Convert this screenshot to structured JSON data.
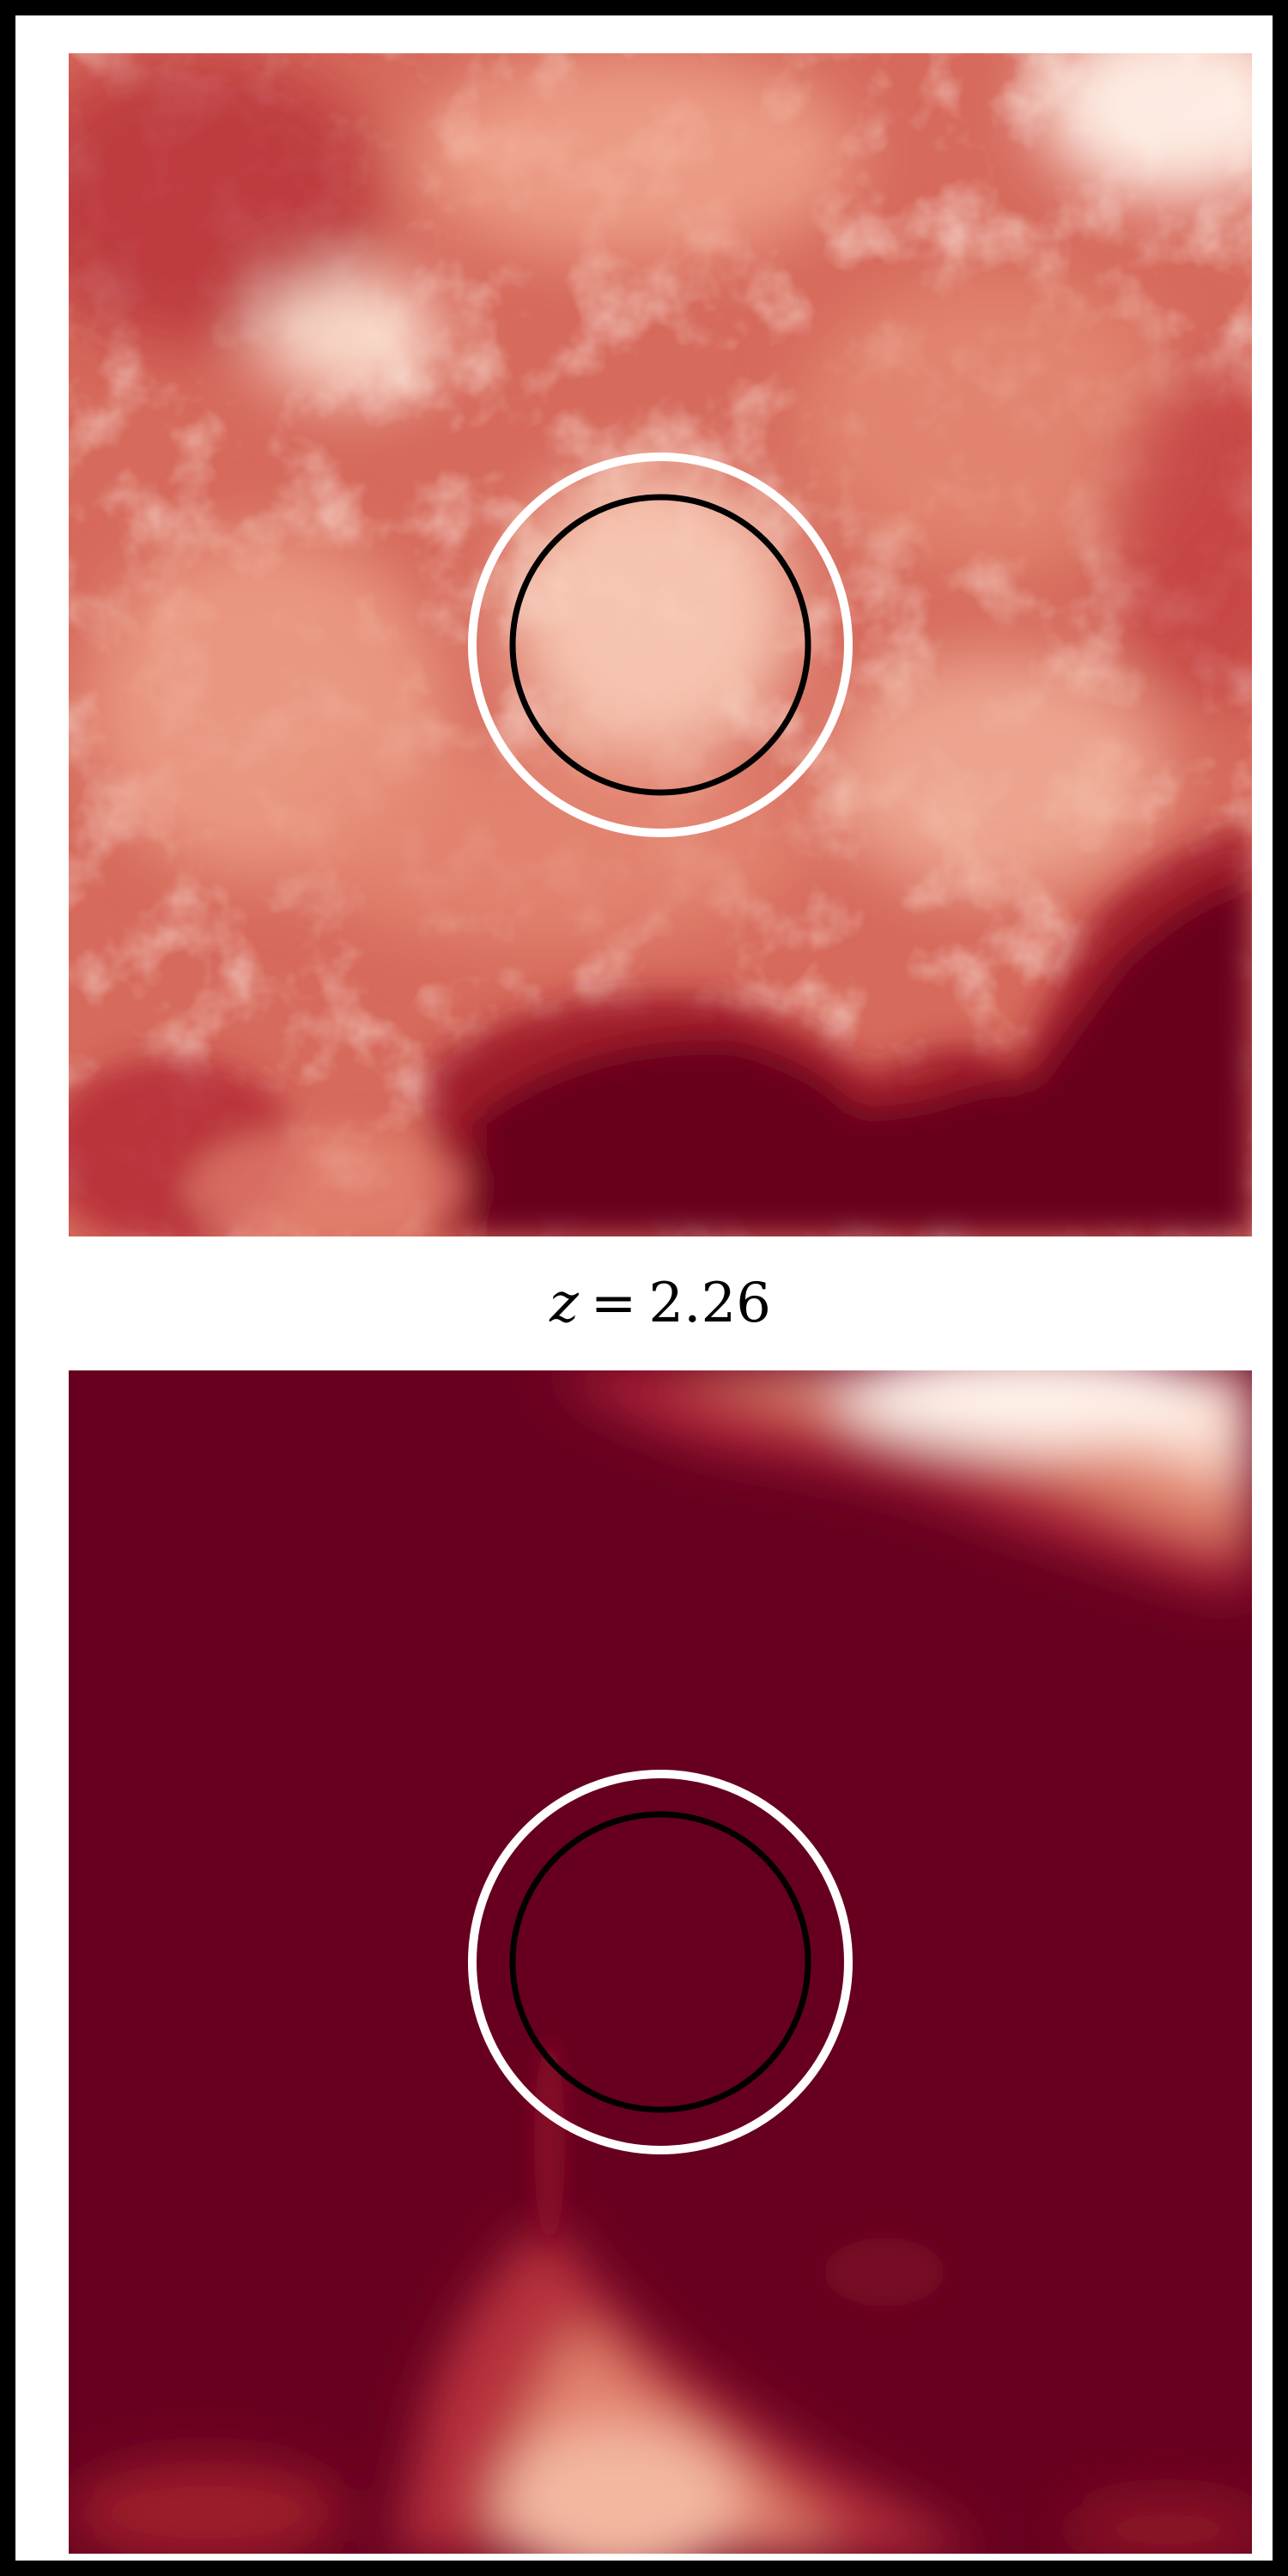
{
  "caption": {
    "variable": "z",
    "equals": "=",
    "value": "2.26"
  },
  "colors": {
    "frame": "#000000",
    "background": "#ffffff",
    "colormap_dark": "#67001f",
    "colormap_mid": "#c73a3d",
    "colormap_light": "#fddbc7",
    "colormap_lightest": "#fff5ee",
    "outer_ring": "#ffffff",
    "inner_ring": "#000000"
  },
  "panels": [
    {
      "name": "top-map",
      "description_icon": "density-map"
    },
    {
      "name": "bottom-map",
      "description_icon": "density-map"
    }
  ]
}
